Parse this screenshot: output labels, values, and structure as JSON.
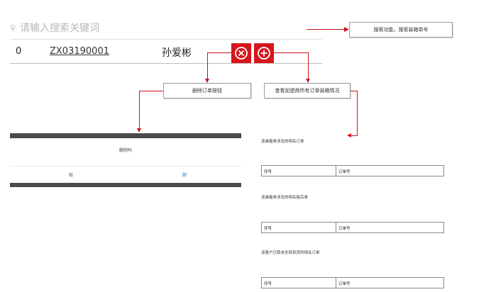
{
  "search": {
    "placeholder": "请输入搜索关键词",
    "icon": "search-icon"
  },
  "record": {
    "index": "0",
    "order_no": "ZX03190001",
    "name": "孙爱彬"
  },
  "actions": {
    "delete_icon": "close-circle-icon",
    "add_icon": "plus-circle-icon",
    "accent": "#d7151d"
  },
  "annotations": {
    "search_note": "搜索功能，搜索装箱单号",
    "delete_note": "删除订单按钮",
    "view_note": "查看加盟商所有订单装箱情况"
  },
  "delete_dialog": {
    "title": "删除吗",
    "cancel": "取",
    "confirm": "删"
  },
  "orders_panel": {
    "sections": [
      {
        "title": "该装箱单涉及的相关订单",
        "col1": "序号",
        "col2": "订单号"
      },
      {
        "title": "该装箱单涉及的相关售后单",
        "col1": "序号",
        "col2": "订单号"
      },
      {
        "title": "该客户已取未全部发货的相关订单",
        "col1": "序号",
        "col2": "订单号"
      }
    ]
  },
  "colors": {
    "line": "#c8141a",
    "dark_bar": "#4b4b4b",
    "link_blue": "#3b7bd8"
  }
}
